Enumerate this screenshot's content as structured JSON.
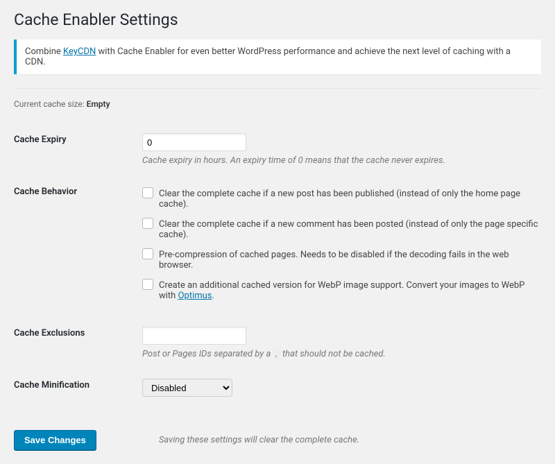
{
  "page_title": "Cache Enabler Settings",
  "notice": {
    "prefix": "Combine ",
    "link_text": "KeyCDN",
    "suffix": " with Cache Enabler for even better WordPress performance and achieve the next level of caching with a CDN."
  },
  "cache_size": {
    "label": "Current cache size: ",
    "value": "Empty"
  },
  "expiry": {
    "label": "Cache Expiry",
    "value": "0",
    "description": "Cache expiry in hours. An expiry time of 0 means that the cache never expires."
  },
  "behavior": {
    "label": "Cache Behavior",
    "opts": [
      {
        "text": "Clear the complete cache if a new post has been published (instead of only the home page cache)."
      },
      {
        "text": "Clear the complete cache if a new comment has been posted (instead of only the page specific cache)."
      },
      {
        "text": "Pre-compression of cached pages. Needs to be disabled if the decoding fails in the web browser."
      },
      {
        "text_before": "Create an additional cached version for WebP image support. Convert your images to WebP with ",
        "link": "Optimus",
        "text_after": "."
      }
    ]
  },
  "exclusions": {
    "label": "Cache Exclusions",
    "value": "",
    "desc_before": "Post or Pages IDs separated by a ",
    "desc_code": ",",
    "desc_after": " that should not be cached."
  },
  "minification": {
    "label": "Cache Minification",
    "selected": "Disabled"
  },
  "submit": {
    "button": "Save Changes",
    "note": "Saving these settings will clear the complete cache."
  }
}
